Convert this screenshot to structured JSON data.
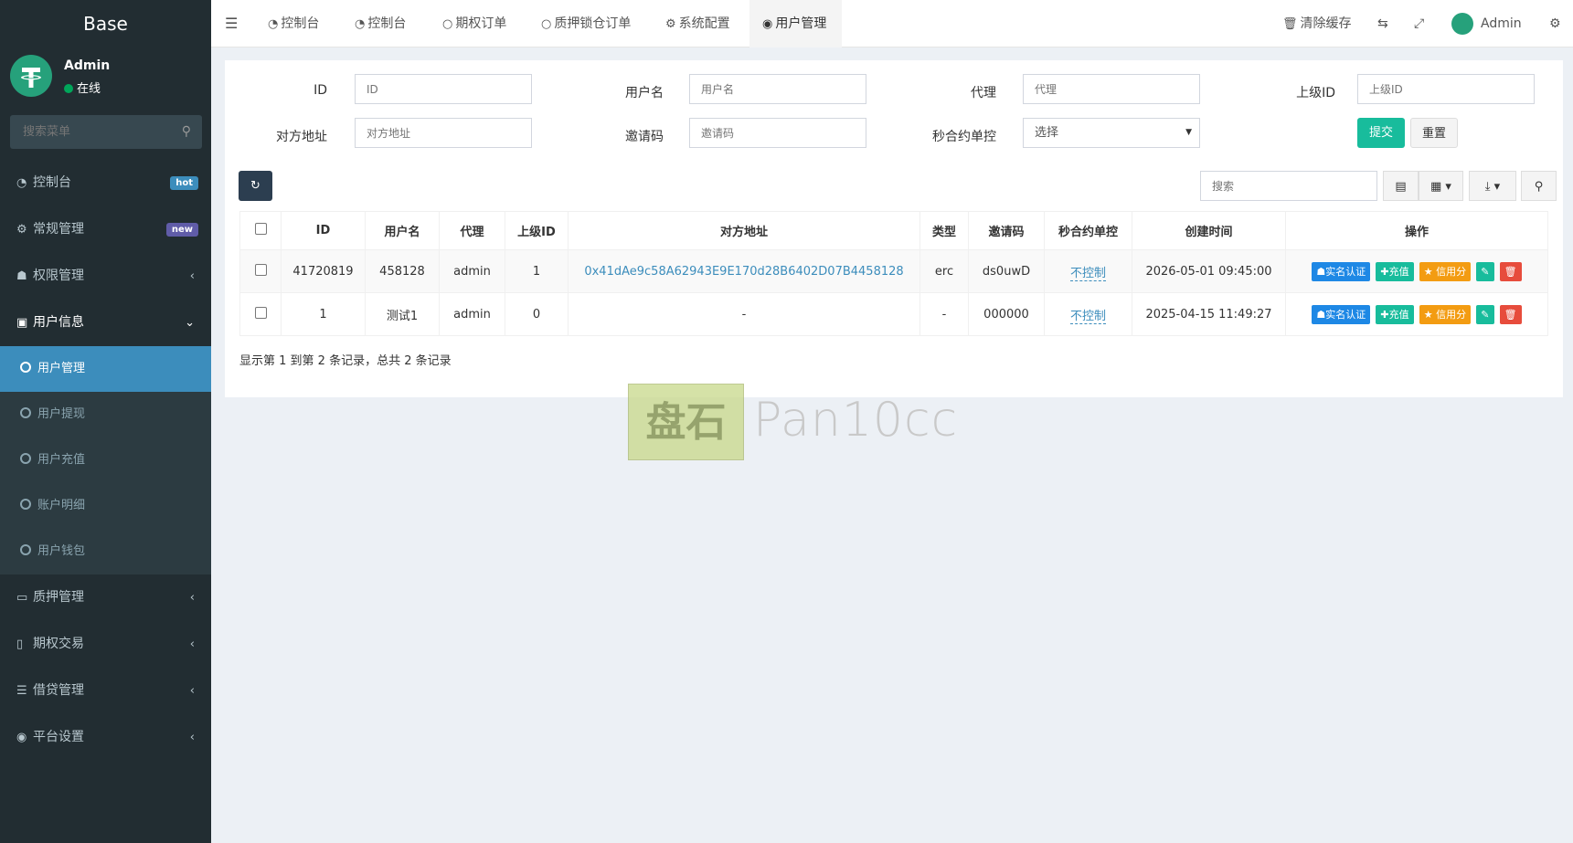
{
  "sidebar": {
    "brand": "Base",
    "user": {
      "name": "Admin",
      "status": "在线"
    },
    "search_placeholder": "搜索菜单",
    "items": [
      {
        "label": "控制台",
        "icon": "dashboard-icon",
        "badge": "hot",
        "badge_color": "#3c8dbc"
      },
      {
        "label": "常规管理",
        "icon": "cogs-icon",
        "badge": "new",
        "badge_color": "#605ca8"
      },
      {
        "label": "权限管理",
        "icon": "group-icon",
        "chevron": "‹"
      },
      {
        "label": "用户信息",
        "icon": "address-book-icon",
        "chevron": "⌄"
      }
    ],
    "subitems": [
      {
        "label": "用户管理",
        "active": true
      },
      {
        "label": "用户提现"
      },
      {
        "label": "用户充值"
      },
      {
        "label": "账户明细"
      },
      {
        "label": "用户钱包"
      }
    ],
    "items2": [
      {
        "label": "质押管理",
        "icon": "credit-card-icon"
      },
      {
        "label": "期权交易",
        "icon": "file-icon"
      },
      {
        "label": "借贷管理",
        "icon": "list-icon"
      },
      {
        "label": "平台设置",
        "icon": "dot-circle-icon"
      }
    ]
  },
  "topbar": {
    "tabs": [
      "控制台",
      "控制台",
      "期权订单",
      "质押锁仓订单",
      "系统配置",
      "用户管理"
    ],
    "clear_cache": "清除缓存",
    "admin": "Admin"
  },
  "filters": {
    "id_label": "ID",
    "id_placeholder": "ID",
    "username_label": "用户名",
    "username_placeholder": "用户名",
    "agent_label": "代理",
    "agent_placeholder": "代理",
    "parent_label": "上级ID",
    "parent_placeholder": "上级ID",
    "address_label": "对方地址",
    "address_placeholder": "对方地址",
    "invite_label": "邀请码",
    "invite_placeholder": "邀请码",
    "control_label": "秒合约单控",
    "control_value": "选择",
    "submit": "提交",
    "reset": "重置"
  },
  "toolbar": {
    "search_placeholder": "搜索"
  },
  "table": {
    "headers": [
      "ID",
      "用户名",
      "代理",
      "上级ID",
      "对方地址",
      "类型",
      "邀请码",
      "秒合约单控",
      "创建时间",
      "操作"
    ],
    "rows": [
      {
        "id": "41720819",
        "username": "458128",
        "agent": "admin",
        "parent": "1",
        "address": "0x41dAe9c58A62943E9E170d28B6402D07B4458128",
        "type": "erc",
        "invite": "ds0uwD",
        "control": "不控制",
        "created": "2026-05-01 09:45:00"
      },
      {
        "id": "1",
        "username": "测试1",
        "agent": "admin",
        "parent": "0",
        "address": "-",
        "type": "-",
        "invite": "000000",
        "control": "不控制",
        "created": "2025-04-15 11:49:27"
      }
    ],
    "actions": {
      "verify": "实名认证",
      "recharge": "充值",
      "credit": "信用分"
    }
  },
  "summary": "显示第 1 到第 2 条记录，总共 2 条记录",
  "watermark": {
    "logo": "盘石",
    "text": "Pan10cc"
  }
}
